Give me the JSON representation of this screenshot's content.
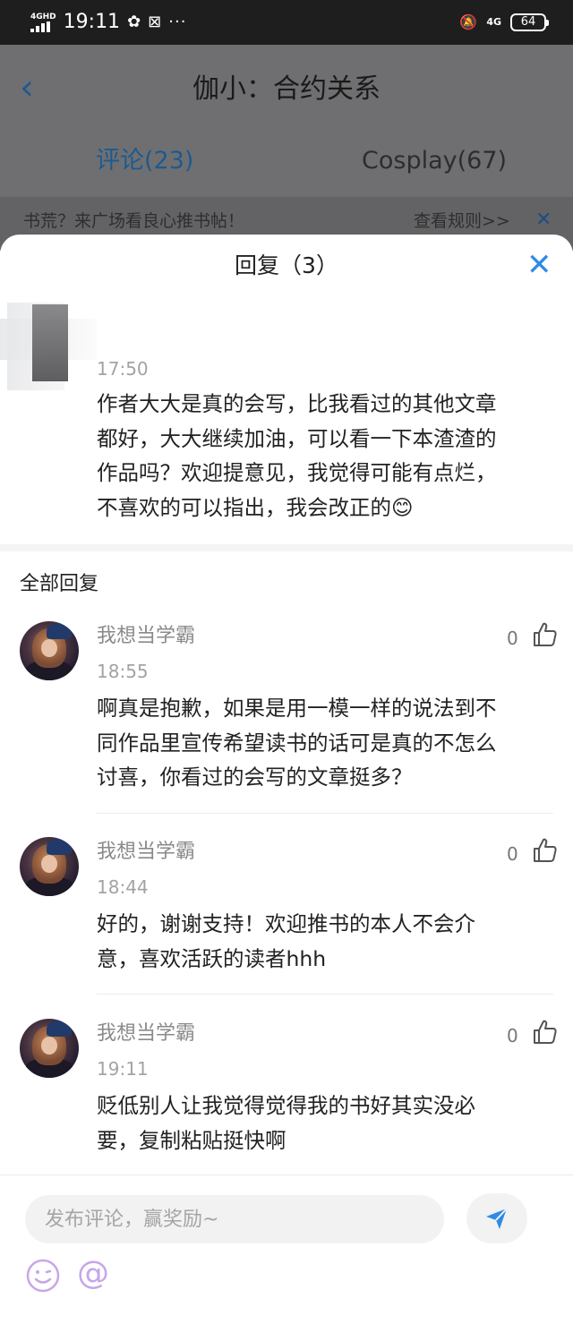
{
  "status_bar": {
    "network_left": "4GHD",
    "time": "19:11",
    "more": "···",
    "network_right": "4G",
    "battery": "64"
  },
  "background": {
    "title": "伽小：合约关系",
    "tabs": [
      {
        "label": "评论(23)",
        "active": true
      },
      {
        "label": "Cosplay(67)",
        "active": false
      }
    ],
    "banner_text": "书荒？来广场看良心推书帖！",
    "banner_link": "查看规则>>",
    "accent_color": "#1d5a8f"
  },
  "sheet": {
    "title": "回复（3）",
    "close_icon": "close-icon",
    "accent_color": "#2f8ae6"
  },
  "original_comment": {
    "time": "17:50",
    "text_lines": [
      "作者大大是真的会写，比我看过的其他文章",
      "都好，大大继续加油，可以看一下本渣渣的",
      "作品吗？欢迎提意见，我觉得可能有点烂，",
      "不喜欢的可以指出，我会改正的😊"
    ]
  },
  "replies_section_label": "全部回复",
  "replies": [
    {
      "name": "我想当学霸",
      "time": "18:55",
      "likes": "0",
      "text_lines": [
        "啊真是抱歉，如果是用一模一样的说法到不",
        "同作品里宣传希望读书的话可是真的不怎么",
        "讨喜，你看过的会写的文章挺多？"
      ]
    },
    {
      "name": "我想当学霸",
      "time": "18:44",
      "likes": "0",
      "text_lines": [
        "好的，谢谢支持！欢迎推书的本人不会介",
        "意，喜欢活跃的读者hhh"
      ]
    },
    {
      "name": "我想当学霸",
      "time": "19:11",
      "likes": "0",
      "text_lines": [
        "贬低别人让我觉得觉得我的书好其实没必",
        "要，复制粘贴挺快啊"
      ]
    }
  ],
  "composer": {
    "placeholder": "发布评论，赢奖励~",
    "send_icon": "send-icon",
    "emoji_icon": "emoji-icon",
    "mention_label": "@",
    "send_color": "#2f8ae6",
    "icon_color": "#c7a6e9"
  }
}
